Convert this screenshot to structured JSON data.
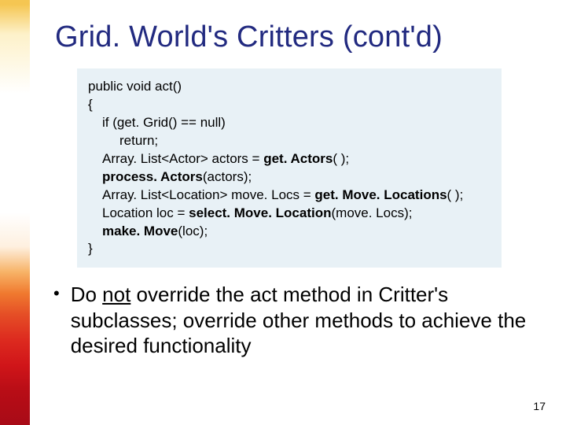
{
  "title": "Grid. World's Critters (cont'd)",
  "code": {
    "l0": "public void act()",
    "l1": "{",
    "l2a": "if (get. Grid() == null)",
    "l2b": "return;",
    "l3a": "Array. List<Actor> actors = ",
    "l3b": "get. Actors",
    "l3c": "( );",
    "l4a": "process. Actors",
    "l4b": "(actors);",
    "l5a": "Array. List<Location> move. Locs = ",
    "l5b": "get. Move. Locations",
    "l5c": "( );",
    "l6a": "Location loc = ",
    "l6b": "select. Move. Location",
    "l6c": "(move. Locs);",
    "l7a": "make. Move",
    "l7b": "(loc);",
    "l8": "}"
  },
  "bullet": {
    "p1": "Do ",
    "p2": "not",
    "p3": " override the ",
    "p4": "act",
    "p5": " method in Critter's subclasses; override other methods to achieve the desired functionality"
  },
  "page_number": "17"
}
